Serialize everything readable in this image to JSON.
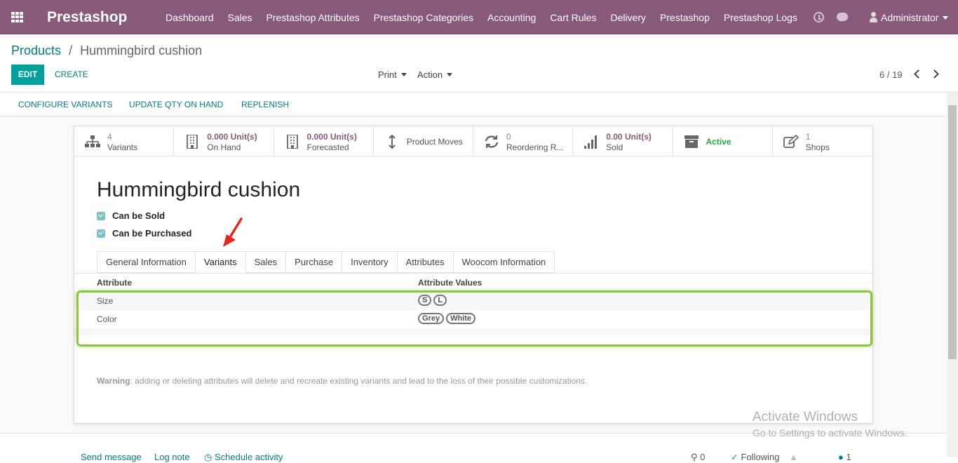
{
  "topbar": {
    "brand": "Prestashop",
    "menu": [
      "Dashboard",
      "Sales",
      "Prestashop Attributes",
      "Prestashop Categories",
      "Accounting",
      "Cart Rules",
      "Delivery",
      "Prestashop",
      "Prestashop Logs"
    ],
    "user": "Administrator"
  },
  "breadcrumb": {
    "parent": "Products",
    "separator": "/",
    "current": "Hummingbird cushion"
  },
  "controls": {
    "edit": "EDIT",
    "create": "CREATE",
    "print": "Print",
    "action": "Action",
    "pager": "6 / 19"
  },
  "statusbar": {
    "configure": "CONFIGURE VARIANTS",
    "update_qty": "UPDATE QTY ON HAND",
    "replenish": "REPLENISH"
  },
  "smart_buttons": {
    "variants": {
      "value": "4",
      "label": "Variants"
    },
    "on_hand": {
      "value": "0.000 Unit(s)",
      "label": "On Hand"
    },
    "forecasted": {
      "value": "0.000 Unit(s)",
      "label": "Forecasted"
    },
    "moves": {
      "label": "Product Moves"
    },
    "reordering": {
      "value": "0",
      "label": "Reordering R..."
    },
    "sold": {
      "value": "0.00 Unit(s)",
      "label": "Sold"
    },
    "active": {
      "label": "Active"
    },
    "shops": {
      "value": "1",
      "label": "Shops"
    }
  },
  "product": {
    "name": "Hummingbird cushion",
    "can_be_sold": "Can be Sold",
    "can_be_purchased": "Can be Purchased"
  },
  "tabs": [
    "General Information",
    "Variants",
    "Sales",
    "Purchase",
    "Inventory",
    "Attributes",
    "Woocom Information"
  ],
  "variants_table": {
    "headers": [
      "Attribute",
      "Attribute Values"
    ],
    "rows": [
      {
        "attribute": "Size",
        "values": [
          "S",
          "L"
        ]
      },
      {
        "attribute": "Color",
        "values": [
          "Grey",
          "White"
        ]
      }
    ]
  },
  "warning": {
    "strong": "Warning",
    "text": ": adding or deleting attributes will delete and recreate existing variants and lead to the loss of their possible customizations."
  },
  "watermark": {
    "line1": "Activate Windows",
    "line2": "Go to Settings to activate Windows."
  },
  "chatter": {
    "send": "Send message",
    "log": "Log note",
    "schedule": "Schedule activity",
    "attachments": "0",
    "following": "Following",
    "followers": "1"
  },
  "colors": {
    "topbar": "#875a7b",
    "primary": "#00a09d",
    "link": "#017e84",
    "highlight": "#8cc63e",
    "active": "#28a745"
  }
}
